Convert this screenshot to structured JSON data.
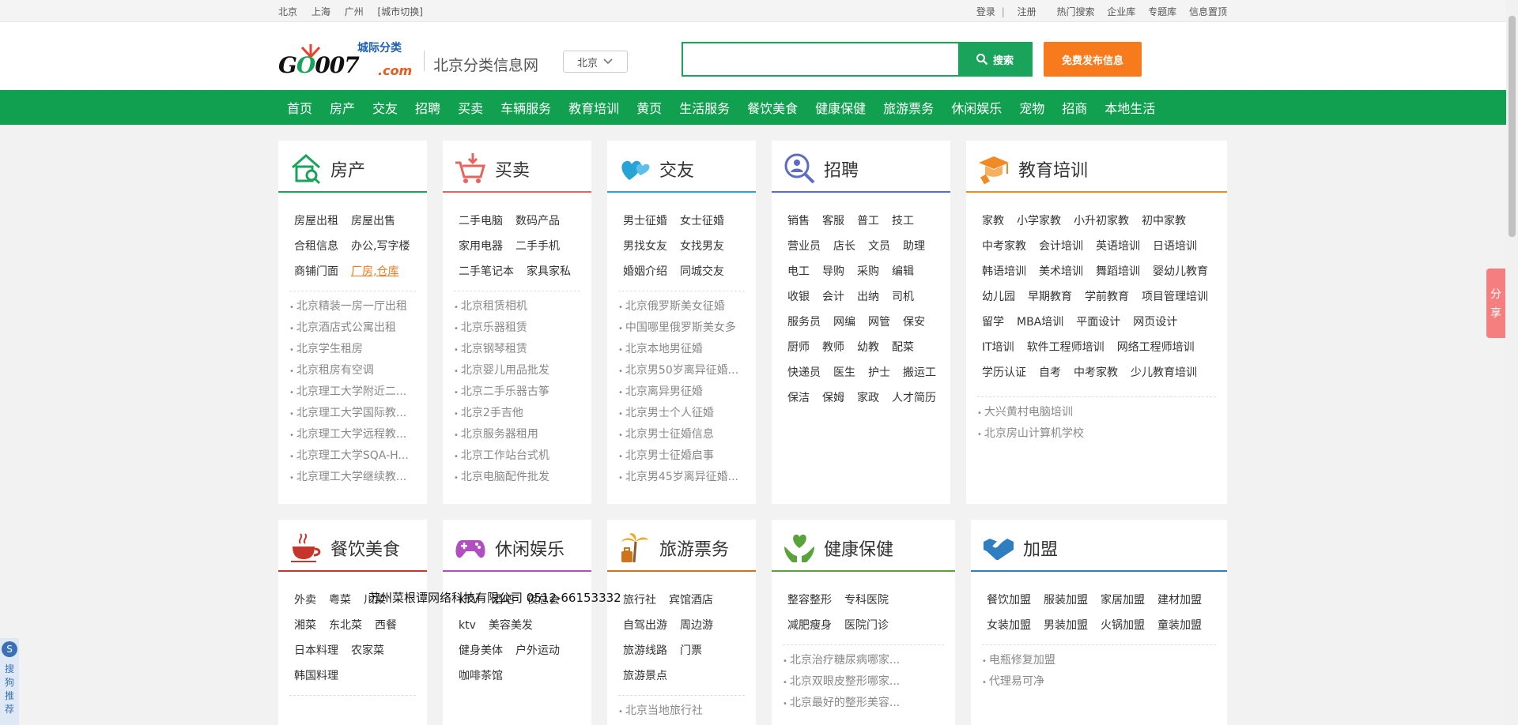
{
  "topbar": {
    "cities": [
      "北京",
      "上海",
      "广州",
      "[城市切换]"
    ],
    "login": "登录",
    "sep": "|",
    "register": "注册",
    "links": [
      "热门搜索",
      "企业库",
      "专题库",
      "信息置顶"
    ]
  },
  "header": {
    "logo_main": "G",
    "logo_o": "O",
    "logo_rest": "007",
    "logo_com": ".com",
    "logo_tag": "城际分类",
    "site_title": "北京分类信息网",
    "city": "北京",
    "search_placeholder": "",
    "search_label": "搜索",
    "post_label": "免费发布信息"
  },
  "nav": [
    "首页",
    "房产",
    "交友",
    "招聘",
    "买卖",
    "车辆服务",
    "教育培训",
    "黄页",
    "生活服务",
    "餐饮美食",
    "健康保健",
    "旅游票务",
    "休闲娱乐",
    "宠物",
    "招商",
    "本地生活"
  ],
  "colors": {
    "green": "#11a04f",
    "orange": "#f77a1d",
    "house": "#1aa35a",
    "buy": "#e8635c",
    "friend": "#27a3d6",
    "job": "#5b6bc6",
    "edu": "#f08a24",
    "food": "#c7352b",
    "fun": "#b04fc0",
    "travel": "#d0741c",
    "health": "#5aa23c",
    "join": "#2f7fc0"
  },
  "cards": {
    "house": {
      "title": "房产",
      "links": [
        "房屋出租",
        "房屋出售",
        "合租信息",
        "办公,写字楼",
        "商铺门面",
        "厂房,仓库"
      ],
      "sublinks": [
        "北京精装一房一厅出租",
        "北京酒店式公寓出租",
        "北京学生租房",
        "北京租房有空调",
        "北京理工大学附近二...",
        "北京理工大学国际教...",
        "北京理工大学远程教...",
        "北京理工大学SQA-H...",
        "北京理工大学继续教..."
      ]
    },
    "buy": {
      "title": "买卖",
      "links": [
        "二手电脑",
        "数码产品",
        "家用电器",
        "二手手机",
        "二手笔记本",
        "家具家私"
      ],
      "sublinks": [
        "北京租赁相机",
        "北京乐器租赁",
        "北京钢琴租赁",
        "北京婴儿用品批发",
        "北京二手乐器古筝",
        "北京2手吉他",
        "北京服务器租用",
        "北京工作站台式机",
        "北京电脑配件批发"
      ]
    },
    "friend": {
      "title": "交友",
      "links": [
        "男士征婚",
        "女士征婚",
        "男找女友",
        "女找男友",
        "婚姻介绍",
        "同城交友"
      ],
      "sublinks": [
        "北京俄罗斯美女征婚",
        "中国哪里俄罗斯美女多",
        "北京本地男征婚",
        "北京男50岁离异征婚...",
        "北京离异男征婚",
        "北京男士个人征婚",
        "北京男士征婚信息",
        "北京男士征婚启事",
        "北京男45岁离异征婚..."
      ]
    },
    "job": {
      "title": "招聘",
      "links": [
        "销售",
        "客服",
        "普工",
        "技工",
        "营业员",
        "店长",
        "文员",
        "助理",
        "电工",
        "导购",
        "采购",
        "编辑",
        "收银",
        "会计",
        "出纳",
        "司机",
        "服务员",
        "网编",
        "网管",
        "保安",
        "厨师",
        "教师",
        "幼教",
        "配菜",
        "快递员",
        "医生",
        "护士",
        "搬运工",
        "保洁",
        "保姆",
        "家政",
        "人才简历"
      ]
    },
    "edu": {
      "title": "教育培训",
      "links": [
        "家教",
        "小学家教",
        "小升初家教",
        "初中家教",
        "中考家教",
        "会计培训",
        "英语培训",
        "日语培训",
        "韩语培训",
        "美术培训",
        "舞蹈培训",
        "婴幼儿教育",
        "幼儿园",
        "早期教育",
        "学前教育",
        "项目管理培训",
        "留学",
        "MBA培训",
        "平面设计",
        "网页设计",
        "IT培训",
        "软件工程师培训",
        "网络工程师培训",
        "学历认证",
        "自考",
        "中考家教",
        "少儿教育培训"
      ],
      "sublinks": [
        "大兴黄村电脑培训",
        "北京房山计算机学校"
      ]
    },
    "food": {
      "title": "餐饮美食",
      "links": [
        "外卖",
        "粤菜",
        "川菜",
        "湘菜",
        "东北菜",
        "西餐",
        "日本料理",
        "农家菜",
        "韩国料理"
      ]
    },
    "fun": {
      "title": "休闲娱乐",
      "links": [
        "KTV",
        "酒吧",
        "夜总会",
        "ktv",
        "美容美发",
        "健身美体",
        "户外运动",
        "咖啡茶馆"
      ]
    },
    "travel": {
      "title": "旅游票务",
      "links": [
        "旅行社",
        "宾馆酒店",
        "自驾出游",
        "周边游",
        "旅游线路",
        "门票",
        "旅游景点"
      ],
      "sublinks": [
        "北京当地旅行社"
      ]
    },
    "health": {
      "title": "健康保健",
      "links": [
        "整容整形",
        "专科医院",
        "减肥瘦身",
        "医院门诊"
      ],
      "sublinks": [
        "北京治疗糖尿病哪家...",
        "北京双眼皮整形哪家...",
        "北京最好的整形美容..."
      ]
    },
    "join": {
      "title": "加盟",
      "links": [
        "餐饮加盟",
        "服装加盟",
        "家居加盟",
        "建材加盟",
        "女装加盟",
        "男装加盟",
        "火锅加盟",
        "童装加盟"
      ],
      "sublinks": [
        "电瓶修复加盟",
        "代理易可净"
      ]
    }
  },
  "overlay_text": "苏州菜根谭网络科技有限公司 0512-66153332",
  "float_share": [
    "分",
    "享"
  ],
  "float_sogou": [
    "S",
    "搜",
    "狗",
    "推",
    "荐"
  ]
}
